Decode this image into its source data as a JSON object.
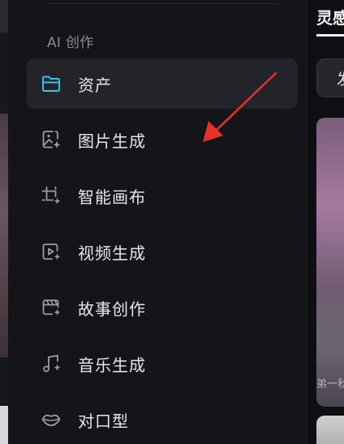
{
  "sidebar": {
    "section_label": "AI 创作",
    "items": [
      {
        "label": "资产",
        "icon": "folder-icon",
        "active": true
      },
      {
        "label": "图片生成",
        "icon": "image-sparkle-icon",
        "active": false
      },
      {
        "label": "智能画布",
        "icon": "crop-canvas-icon",
        "active": false
      },
      {
        "label": "视频生成",
        "icon": "video-sparkle-icon",
        "active": false
      },
      {
        "label": "故事创作",
        "icon": "story-board-icon",
        "active": false
      },
      {
        "label": "音乐生成",
        "icon": "music-note-icon",
        "active": false
      },
      {
        "label": "对口型",
        "icon": "lips-icon",
        "active": false
      }
    ]
  },
  "content": {
    "title": "灵感",
    "filter_chip": "发",
    "card_caption": "弟一秋"
  },
  "colors": {
    "background": "#0e0f13",
    "sidebar": "#141519",
    "active_item": "#22242a",
    "accent_icon": "#35c4e8",
    "annotation_arrow": "#e8302a"
  }
}
